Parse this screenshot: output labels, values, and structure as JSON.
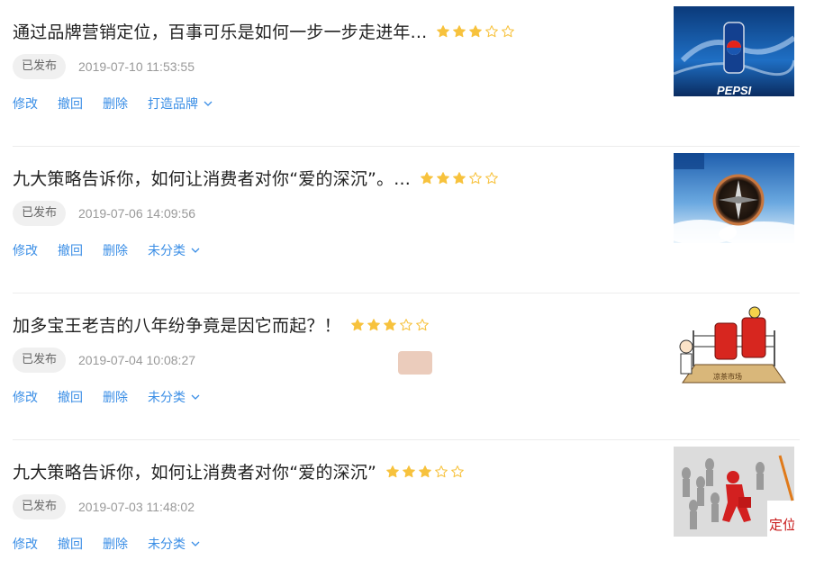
{
  "articles": [
    {
      "title": "通过品牌营销定位，百事可乐是如何一步一步走进年...",
      "rating": 3,
      "rating_max": 5,
      "status": "已发布",
      "date": "2019-07-10 11:53:55",
      "actions": [
        "修改",
        "撤回",
        "删除"
      ],
      "category": "打造品牌",
      "thumbnail_text": "PEPSI"
    },
    {
      "title": "九大策略告诉你，如何让消费者对你“爱的深沉”。...",
      "rating": 3,
      "rating_max": 5,
      "status": "已发布",
      "date": "2019-07-06 14:09:56",
      "actions": [
        "修改",
        "撤回",
        "删除"
      ],
      "category": "未分类",
      "thumbnail_text": ""
    },
    {
      "title": "加多宝王老吉的八年纷争竟是因它而起？！",
      "rating": 3,
      "rating_max": 5,
      "status": "已发布",
      "date": "2019-07-04 10:08:27",
      "actions": [
        "修改",
        "撤回",
        "删除"
      ],
      "category": "未分类",
      "thumbnail_text": "凉茶市场"
    },
    {
      "title": "九大策略告诉你，如何让消费者对你“爱的深沉”",
      "rating": 3,
      "rating_max": 5,
      "status": "已发布",
      "date": "2019-07-03 11:48:02",
      "actions": [
        "修改",
        "撤回",
        "删除"
      ],
      "category": "未分类",
      "thumbnail_text": "定位"
    }
  ],
  "colors": {
    "link": "#3a8ee6",
    "star_filled": "#f7c23d",
    "star_empty": "#f7c23d",
    "badge_bg": "#f0f0f0"
  },
  "icons": {
    "star_filled": "star-filled-icon",
    "star_empty": "star-outline-icon",
    "dropdown": "chevron-down-icon"
  }
}
